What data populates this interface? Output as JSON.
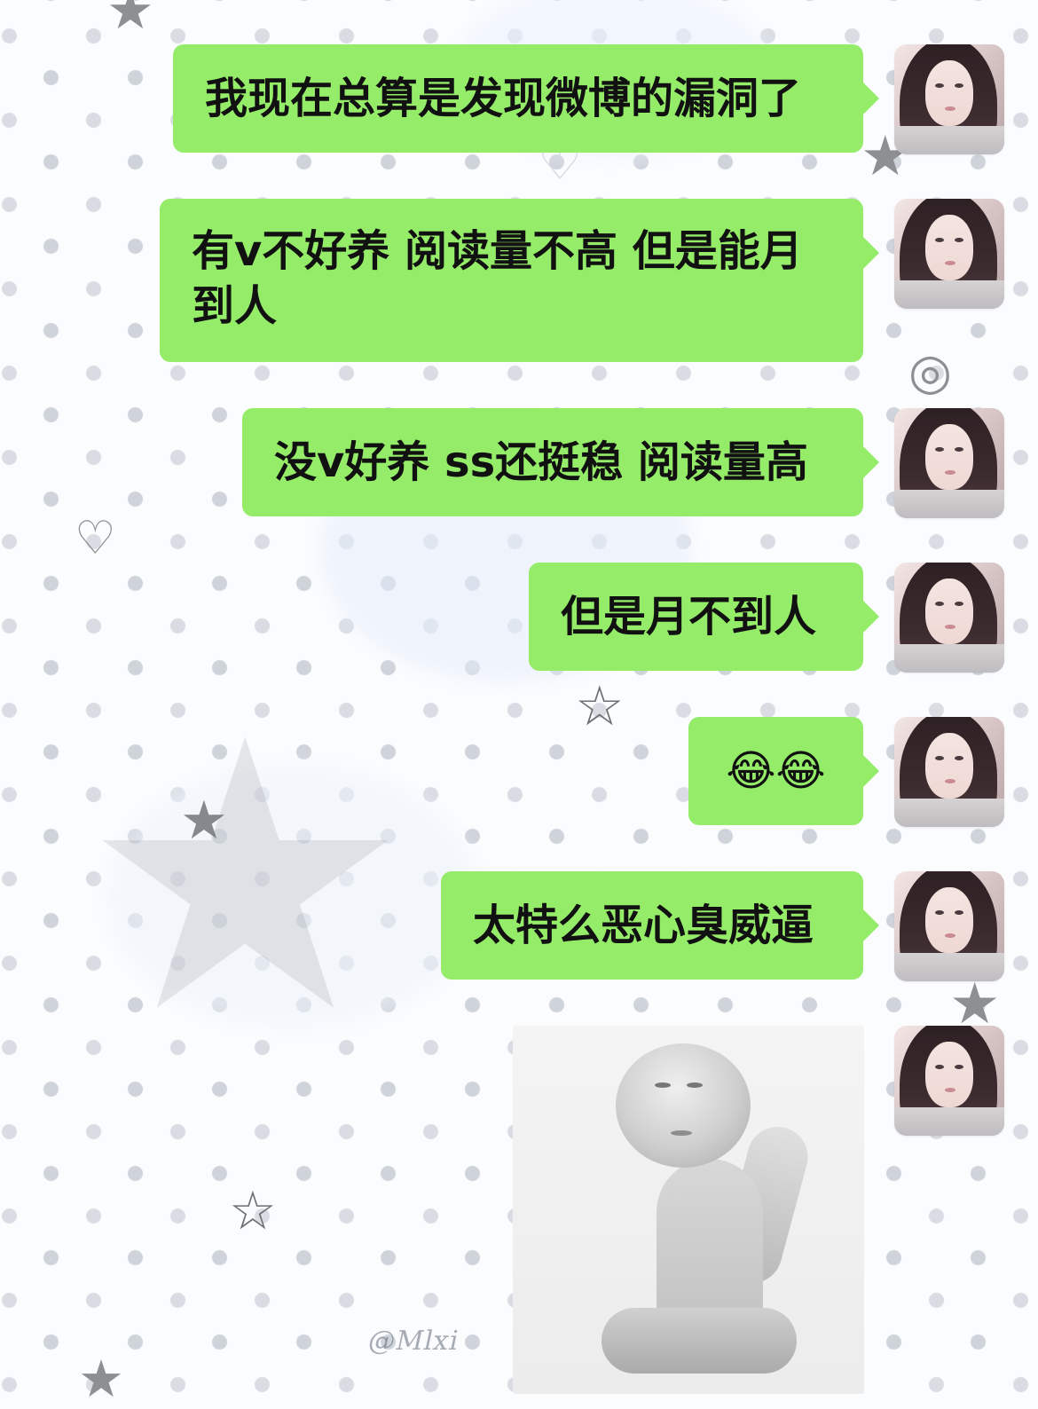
{
  "conversation": {
    "messages": [
      {
        "type": "text",
        "text": "我现在总算是发现微博的漏洞了"
      },
      {
        "type": "text",
        "text": "有v不好养 阅读量不高 但是能月到人"
      },
      {
        "type": "text",
        "text": "没v好养 ss还挺稳 阅读量高"
      },
      {
        "type": "text",
        "text": "但是月不到人"
      },
      {
        "type": "text",
        "text": "😂😂"
      },
      {
        "type": "text",
        "text": "太特么恶心臭威逼"
      },
      {
        "type": "sticker"
      }
    ]
  },
  "watermark": {
    "signature": "@Mlxi"
  },
  "theme": {
    "bubble_color": "#95ec69",
    "background_dots": "#cfd3da",
    "text_color": "#111111"
  }
}
